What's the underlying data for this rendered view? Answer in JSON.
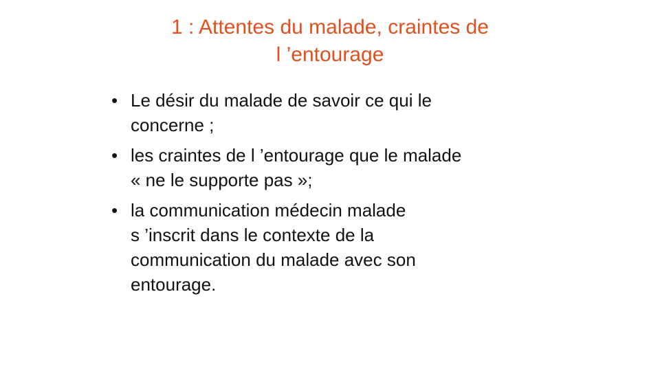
{
  "title": {
    "line1": "1 : Attentes du malade, craintes de",
    "line2": "l ’entourage"
  },
  "bullets": [
    {
      "lines": [
        "Le désir du malade de savoir ce qui le",
        "concerne ;"
      ]
    },
    {
      "lines": [
        "les craintes de l ’entourage que le malade",
        "« ne le supporte pas »;"
      ]
    },
    {
      "lines": [
        "la communication médecin malade",
        "s ’inscrit dans le contexte de la",
        "communication du malade avec son",
        "entourage."
      ]
    }
  ],
  "bullet_symbol": "•",
  "colors": {
    "title": "#e0501e",
    "text": "#111111",
    "background": "#ffffff"
  }
}
